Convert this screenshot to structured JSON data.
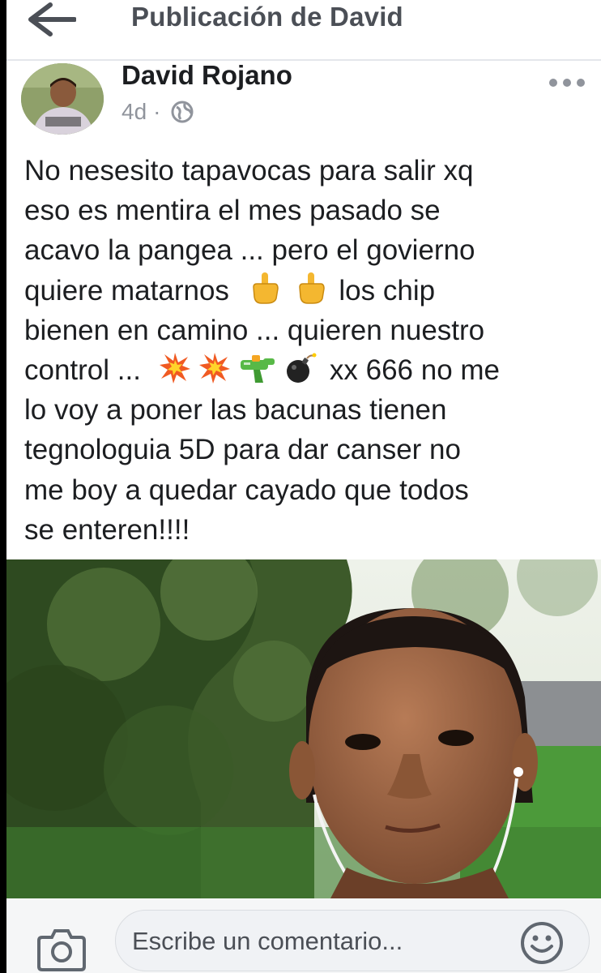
{
  "header": {
    "title": "Publicación de David",
    "back_icon": "arrow-left-icon"
  },
  "post": {
    "author": "David Rojano",
    "time": "4d",
    "separator": "·",
    "audience_icon": "globe-icon",
    "more_icon": "more-dots-icon",
    "text_lines": [
      {
        "a": "No nesesito tapavocas para salir xq",
        "b": ""
      },
      {
        "a": "eso es mentira el mes pasado se",
        "b": ""
      },
      {
        "a": "acavo la pangea  ... pero el govierno",
        "b": ""
      },
      {
        "a": "quiere matarnos",
        "b": "los chip"
      },
      {
        "a": "bienen en camino ... quieren nuestro",
        "b": ""
      },
      {
        "a": "control ...",
        "b": "xx 666 no me"
      },
      {
        "a": "lo voy a poner las bacunas tienen",
        "b": ""
      },
      {
        "a": "tegnologuia 5D para dar canser no",
        "b": ""
      },
      {
        "a": "me boy a quedar cayado que todos",
        "b": ""
      },
      {
        "a": "se enteren!!!!",
        "b": ""
      }
    ],
    "emojis_line4": [
      "middle-finger-icon",
      "middle-finger-icon"
    ],
    "emojis_line6": [
      "explosion-icon",
      "explosion-icon",
      "water-gun-icon",
      "bomb-icon"
    ]
  },
  "comment_bar": {
    "placeholder": "Escribe un comentario...",
    "camera_icon": "camera-icon",
    "emoji_icon": "smiley-icon"
  },
  "colors": {
    "title_gray": "#4b4f56",
    "text": "#1c1e21",
    "meta_gray": "#90949c"
  }
}
